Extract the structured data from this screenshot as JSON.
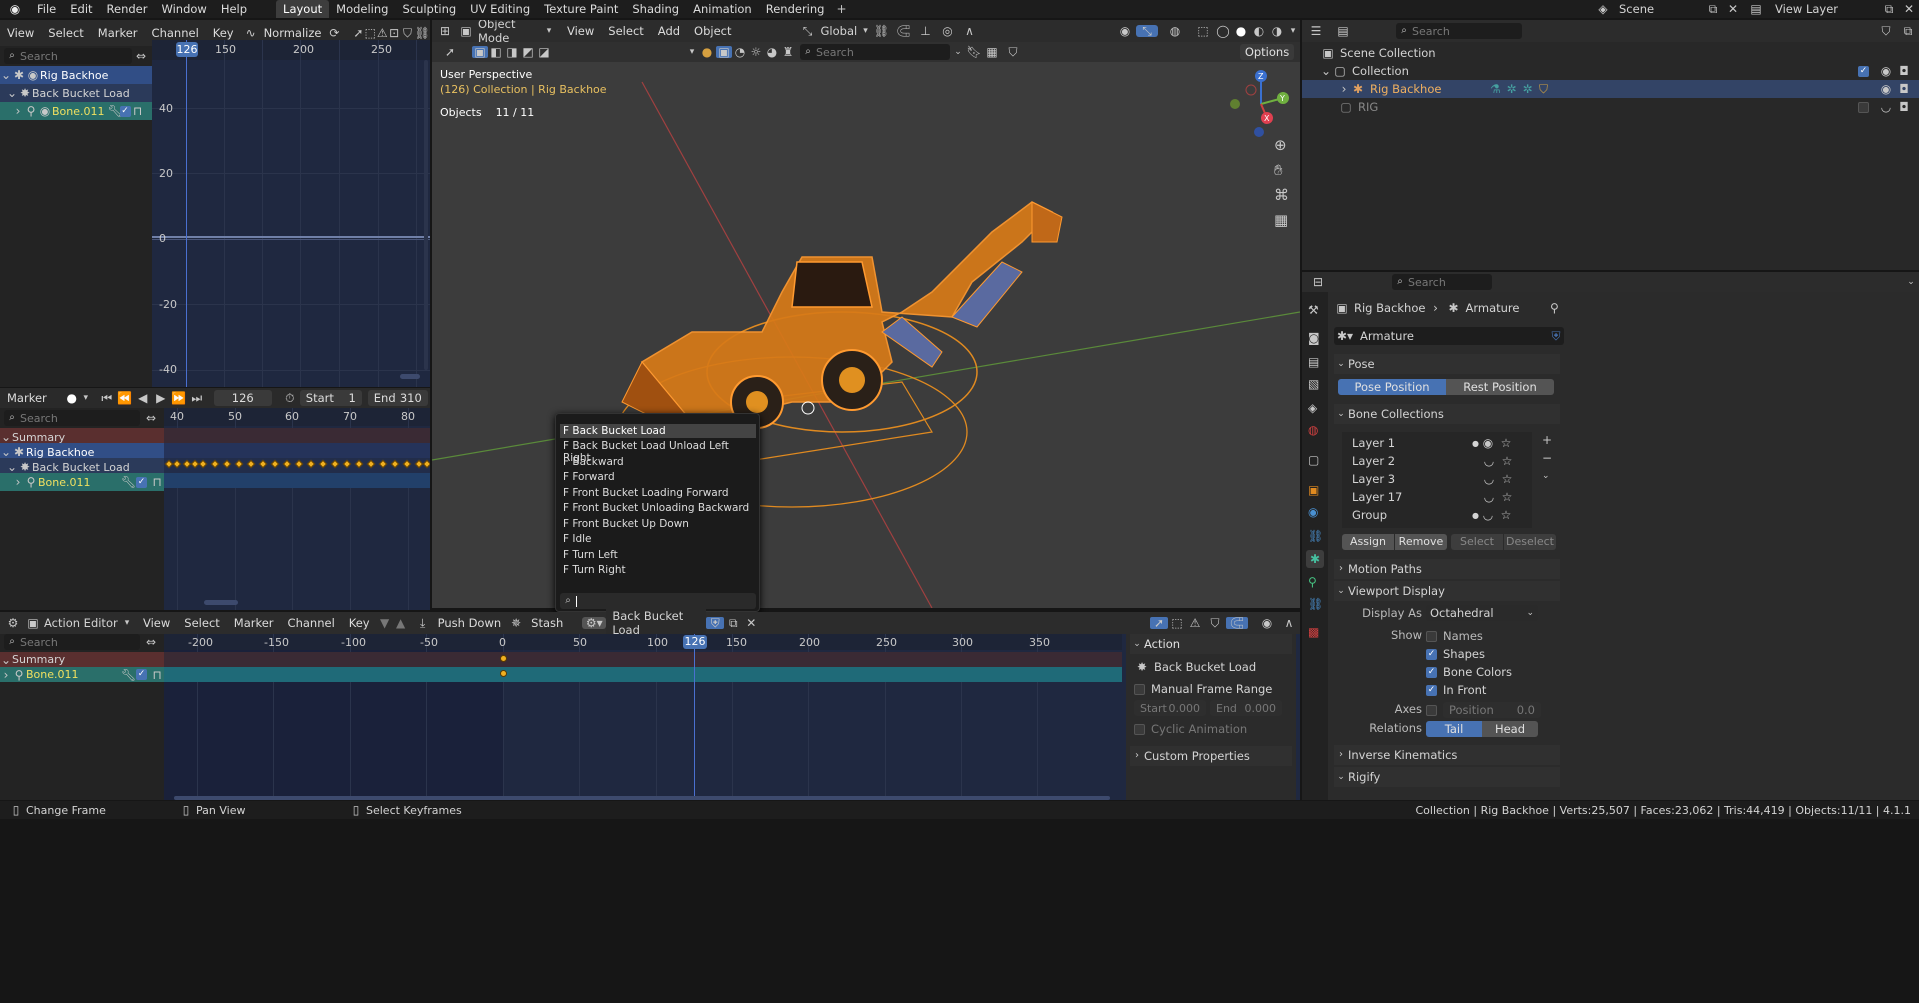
{
  "topbar": {
    "menus": [
      "File",
      "Edit",
      "Render",
      "Window",
      "Help"
    ],
    "workspaces": [
      "Layout",
      "Modeling",
      "Sculpting",
      "UV Editing",
      "Texture Paint",
      "Shading",
      "Animation",
      "Rendering"
    ],
    "active_workspace": "Layout",
    "scene": "Scene",
    "view_layer": "View Layer"
  },
  "graph": {
    "menus": [
      "View",
      "Select",
      "Marker",
      "Channel",
      "Key"
    ],
    "normalize": "Normalize",
    "search_placeholder": "Search",
    "channels": [
      "Rig Backhoe",
      "Back Bucket Load",
      "Bone.011"
    ],
    "frame": "126",
    "x_ticks": [
      "126",
      "150",
      "200",
      "250"
    ],
    "y_ticks": [
      "40",
      "20",
      "0",
      "-20",
      "-40"
    ]
  },
  "timeline": {
    "marker": "Marker",
    "current_frame": "126",
    "start_label": "Start",
    "start": "1",
    "end_label": "End",
    "end": "310",
    "search_placeholder": "Search",
    "ticks": [
      "40",
      "50",
      "60",
      "70",
      "80"
    ],
    "channels": [
      "Summary",
      "Rig Backhoe",
      "Back Bucket Load",
      "Bone.011"
    ]
  },
  "viewport": {
    "mode": "Object Mode",
    "menus": [
      "View",
      "Select",
      "Add",
      "Object"
    ],
    "orientation": "Global",
    "search_placeholder": "Search",
    "options": "Options",
    "info_line1": "User Perspective",
    "info_line2": "(126) Collection | Rig Backhoe",
    "objects_label": "Objects",
    "objects_value": "11 / 11",
    "gizmo": {
      "x": "X",
      "y": "Y",
      "z": "Z"
    }
  },
  "dropdown": {
    "items": [
      "F Back Bucket Load",
      "F Back Bucket Load Unload Left Right",
      "F Backward",
      "F Forward",
      "F Front Bucket Loading Forward",
      "F Front Bucket Unloading Backward",
      "F Front Bucket Up Down",
      "F Idle",
      "F Turn Left",
      "F Turn Right"
    ],
    "selected": "F Back Bucket Load"
  },
  "action_editor": {
    "mode": "Action Editor",
    "menus": [
      "View",
      "Select",
      "Marker",
      "Channel",
      "Key"
    ],
    "push_down": "Push Down",
    "stash": "Stash",
    "action_name": "Back Bucket Load",
    "search_placeholder": "Search",
    "channels": [
      "Summary",
      "Bone.011"
    ],
    "ticks": [
      "-200",
      "-150",
      "-100",
      "-50",
      "0",
      "50",
      "100",
      "126",
      "150",
      "200",
      "250",
      "300",
      "350"
    ],
    "current_frame": "126"
  },
  "action_panel": {
    "title": "Action",
    "name": "Back Bucket Load",
    "manual_range": "Manual Frame Range",
    "start_label": "Start",
    "start": "0.000",
    "end_label": "End",
    "end": "0.000",
    "cyclic": "Cyclic Animation",
    "custom_props": "Custom Properties"
  },
  "outliner": {
    "search_placeholder": "Search",
    "items": [
      "Scene Collection",
      "Collection",
      "Rig Backhoe",
      "RIG"
    ]
  },
  "properties": {
    "search_placeholder": "Search",
    "breadcrumb_obj": "Rig Backhoe",
    "breadcrumb_data": "Armature",
    "data_name": "Armature",
    "pose_section": "Pose",
    "pose_position": "Pose Position",
    "rest_position": "Rest Position",
    "bone_collections": "Bone Collections",
    "layers": [
      "Layer 1",
      "Layer 2",
      "Layer 3",
      "Layer 17",
      "Group"
    ],
    "assign": "Assign",
    "remove": "Remove",
    "select": "Select",
    "deselect": "Deselect",
    "motion_paths": "Motion Paths",
    "viewport_display": "Viewport Display",
    "display_as_label": "Display As",
    "display_as": "Octahedral",
    "show_label": "Show",
    "names": "Names",
    "shapes": "Shapes",
    "bone_colors": "Bone Colors",
    "in_front": "In Front",
    "axes_label": "Axes",
    "position_label": "Position",
    "position_value": "0.0",
    "relations_label": "Relations",
    "tail": "Tail",
    "head": "Head",
    "inverse_kinematics": "Inverse Kinematics",
    "rigify": "Rigify"
  },
  "statusbar": {
    "hint1": "Change Frame",
    "hint2": "Pan View",
    "hint3": "Select Keyframes",
    "stats": "Collection | Rig Backhoe | Verts:25,507 | Faces:23,062 | Tris:44,419 | Objects:11/11 | 4.1.1"
  }
}
